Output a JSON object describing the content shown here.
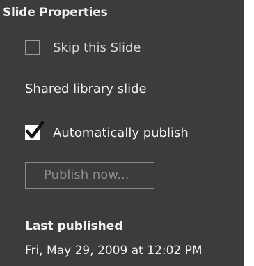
{
  "panel": {
    "title": "Slide Properties",
    "skip_slide": {
      "label": "Skip this Slide",
      "checked": false
    },
    "shared_library_label": "Shared library slide",
    "auto_publish": {
      "label": "Automatically publish",
      "checked": true
    },
    "publish_button_label": "Publish now...",
    "publish_button_enabled": false,
    "last_published_label": "Last published",
    "last_published_value": "Fri, May 29, 2009 at 12:02 PM"
  },
  "colors": {
    "panel_background": "#3c3c3c",
    "text": "#f2f2f2",
    "disabled_text": "#8c8c8c"
  }
}
